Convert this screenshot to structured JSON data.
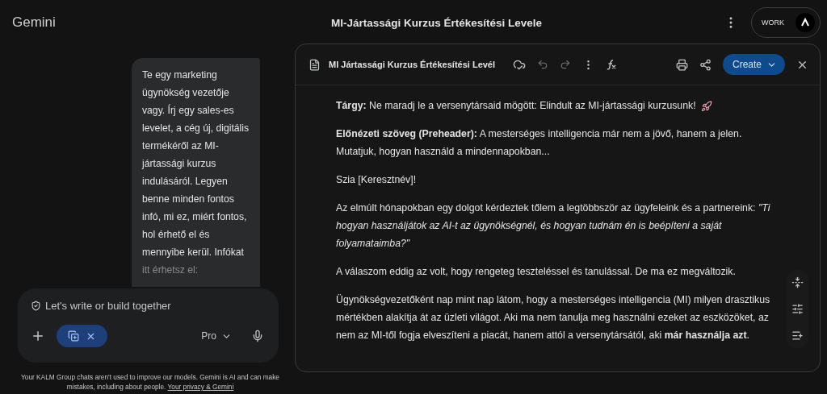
{
  "app": {
    "name": "Gemini"
  },
  "header": {
    "title": "MI-Jártassági Kurzus Értékesítési Levele",
    "account_badge": "WORK"
  },
  "chat": {
    "message_lines": [
      "Te egy marketing",
      "ügynökség vezetője",
      "vagy. Írj egy sales-es",
      "levelet, a cég új, digitális",
      "termékéről az MI-",
      "jártassági kurzus",
      "indulásáról. Legyen",
      "benne minden fontos",
      "infó, mi ez, miért fontos,",
      "hol érhető el és",
      "mennyibe kerül. Infókat",
      "itt érhetsz el:"
    ],
    "input": {
      "placeholder": "Let's write or build together"
    },
    "mode": "Pro",
    "disclaimer": "Your KALM Group chats aren't used to improve our models. Gemini is AI and can make mistakes, including about people.",
    "disclaimer_link": "Your privacy & Gemini"
  },
  "document": {
    "title": "MI Jártassági Kurzus Értékesítési Levél",
    "create_button": "Create",
    "paragraphs": [
      {
        "text": "**Tárgy:** Ne maradj le a versenytársaid mögött: Elindult az MI-jártassági kurzusunk!"
      },
      {
        "text": "**Előnézeti szöveg (Preheader):** A mesterséges intelligencia már nem a jövő, hanem a jelen. Mutatjuk, hogyan használd a mindennapokban..."
      },
      {
        "text": "Szia [Keresztnév]!"
      },
      {
        "text": "Az elmúlt hónapokban egy dolgot kérdeztek tőlem a legtöbbször az ügyfeleink és a partnereink: *\"Ti hogyan használjátok az AI-t az ügynökségnél, és hogyan tudnám én is beépíteni a saját folyamataimba?\"*"
      },
      {
        "text": "A válaszom eddig az volt, hogy rengeteg teszteléssel és tanulással. De ma ez megváltozik."
      },
      {
        "text": "Ügynökségvezetőként nap mint nap látom, hogy a mesterséges intelligencia (MI) milyen drasztikus mértékben alakítja át az üzleti világot. Aki ma nem tanulja meg használni ezeket az eszközöket, az nem az MI-től fogja elveszíteni a piacát, hanem attól a versenytársától, aki **már használja azt**."
      }
    ]
  }
}
